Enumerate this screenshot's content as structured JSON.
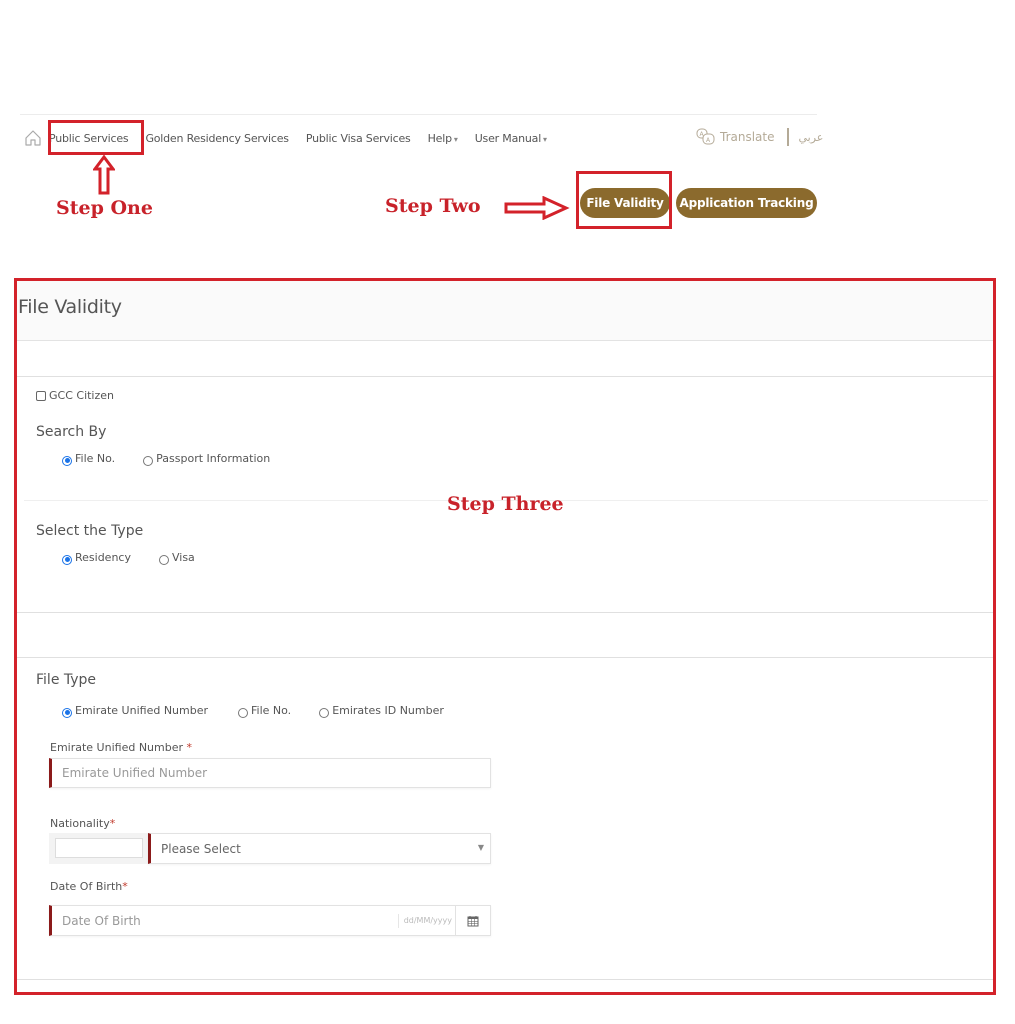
{
  "nav": {
    "items": [
      {
        "label": "Public Services"
      },
      {
        "label": "Golden Residency Services"
      },
      {
        "label": "Public Visa Services"
      },
      {
        "label": "Help",
        "caret": "▾"
      },
      {
        "label": "User Manual",
        "caret": "▾"
      }
    ],
    "translate": "Translate",
    "arabic": "عربي"
  },
  "actions": {
    "file_validity": "File Validity",
    "application_tracking": "Application Tracking"
  },
  "annotations": {
    "step_one": "Step One",
    "step_two": "Step Two",
    "step_three": "Step Three",
    "color": "#d3222a"
  },
  "panel": {
    "title": "File Validity",
    "gcc_citizen": "GCC Citizen",
    "search_by": {
      "label": "Search By",
      "options": [
        "File No.",
        "Passport Information"
      ],
      "selected": "File No."
    },
    "select_type": {
      "label": "Select the Type",
      "options": [
        "Residency",
        "Visa"
      ],
      "selected": "Residency"
    },
    "file_type": {
      "label": "File Type",
      "options": [
        "Emirate Unified Number",
        "File No.",
        "Emirates ID Number"
      ],
      "selected": "Emirate Unified Number"
    },
    "unified_number": {
      "label": "Emirate Unified Number",
      "required_mark": "*",
      "placeholder": "Emirate Unified Number",
      "value": ""
    },
    "nationality": {
      "label": "Nationality",
      "required_mark": "*",
      "code_value": "",
      "selected": "Please Select"
    },
    "dob": {
      "label": "Date Of Birth",
      "required_mark": "*",
      "placeholder": "Date Of Birth",
      "format_hint": "dd/MM/yyyy",
      "value": ""
    }
  },
  "theme": {
    "brand_gold": "#8b6a2d",
    "radio_blue": "#1a73e8",
    "required_bar": "#8b1a1a"
  }
}
